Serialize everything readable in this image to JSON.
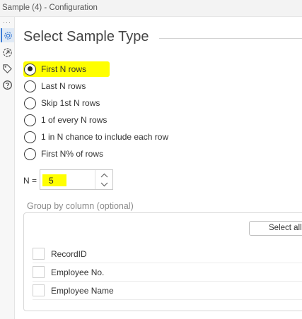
{
  "window": {
    "title": "Sample (4) - Configuration"
  },
  "toolrail": {
    "items": [
      {
        "icon": "gear-icon",
        "active": true
      },
      {
        "icon": "connection-arrow-icon",
        "active": false
      },
      {
        "icon": "tag-icon",
        "active": false
      },
      {
        "icon": "help-icon",
        "active": false
      }
    ]
  },
  "main": {
    "heading": "Select Sample Type",
    "sample_options": [
      {
        "label": "First N rows",
        "selected": true
      },
      {
        "label": "Last N rows",
        "selected": false
      },
      {
        "label": "Skip 1st N rows",
        "selected": false
      },
      {
        "label": "1 of every N rows",
        "selected": false
      },
      {
        "label": "1 in N chance to include each row",
        "selected": false
      },
      {
        "label": "First N% of rows",
        "selected": false
      }
    ],
    "n_field": {
      "label": "N =",
      "value": "5"
    },
    "group_by": {
      "label": "Group by column (optional)",
      "select_all_label": "Select all",
      "columns": [
        {
          "label": "RecordID",
          "checked": false
        },
        {
          "label": "Employee No.",
          "checked": false
        },
        {
          "label": "Employee Name",
          "checked": false
        }
      ]
    }
  },
  "colors": {
    "highlight": "#ffff00",
    "accent": "#3a7bd5"
  }
}
